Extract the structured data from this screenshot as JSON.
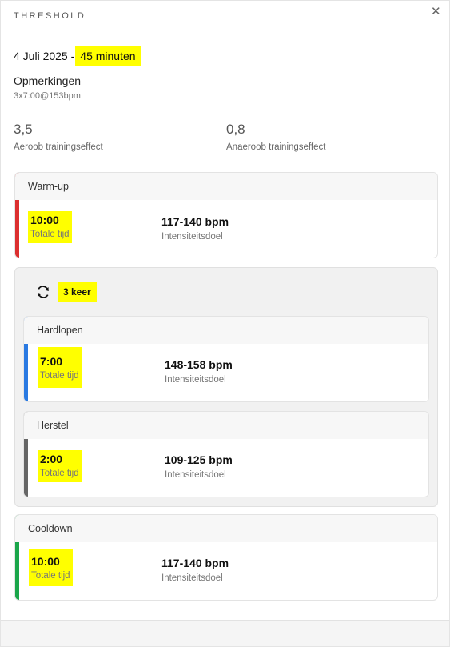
{
  "header": {
    "title": "THRESHOLD",
    "close_icon": "close-icon"
  },
  "workout": {
    "date": "4 Juli 2025",
    "separator": "-",
    "duration": "45 minuten",
    "notes_label": "Opmerkingen",
    "notes": "3x7:00@153bpm"
  },
  "metrics": [
    {
      "value": "3,5",
      "label": "Aeroob trainingseffect"
    },
    {
      "value": "0,8",
      "label": "Anaeroob trainingseffect"
    }
  ],
  "steps": {
    "warmup": {
      "title": "Warm-up",
      "time": "10:00",
      "time_label": "Totale tijd",
      "intensity": "117-140 bpm",
      "intensity_label": "Intensiteitsdoel",
      "color": "#dc2f2f"
    },
    "repeat": {
      "icon": "repeat-icon",
      "label": "3 keer"
    },
    "run": {
      "title": "Hardlopen",
      "time": "7:00",
      "time_label": "Totale tijd",
      "intensity": "148-158 bpm",
      "intensity_label": "Intensiteitsdoel",
      "color": "#2a7ae2"
    },
    "recover": {
      "title": "Herstel",
      "time": "2:00",
      "time_label": "Totale tijd",
      "intensity": "109-125 bpm",
      "intensity_label": "Intensiteitsdoel",
      "color": "#666666"
    },
    "cooldown": {
      "title": "Cooldown",
      "time": "10:00",
      "time_label": "Totale tijd",
      "intensity": "117-140 bpm",
      "intensity_label": "Intensiteitsdoel",
      "color": "#1aa64a"
    }
  },
  "colors": {
    "highlight": "#ffff00"
  }
}
